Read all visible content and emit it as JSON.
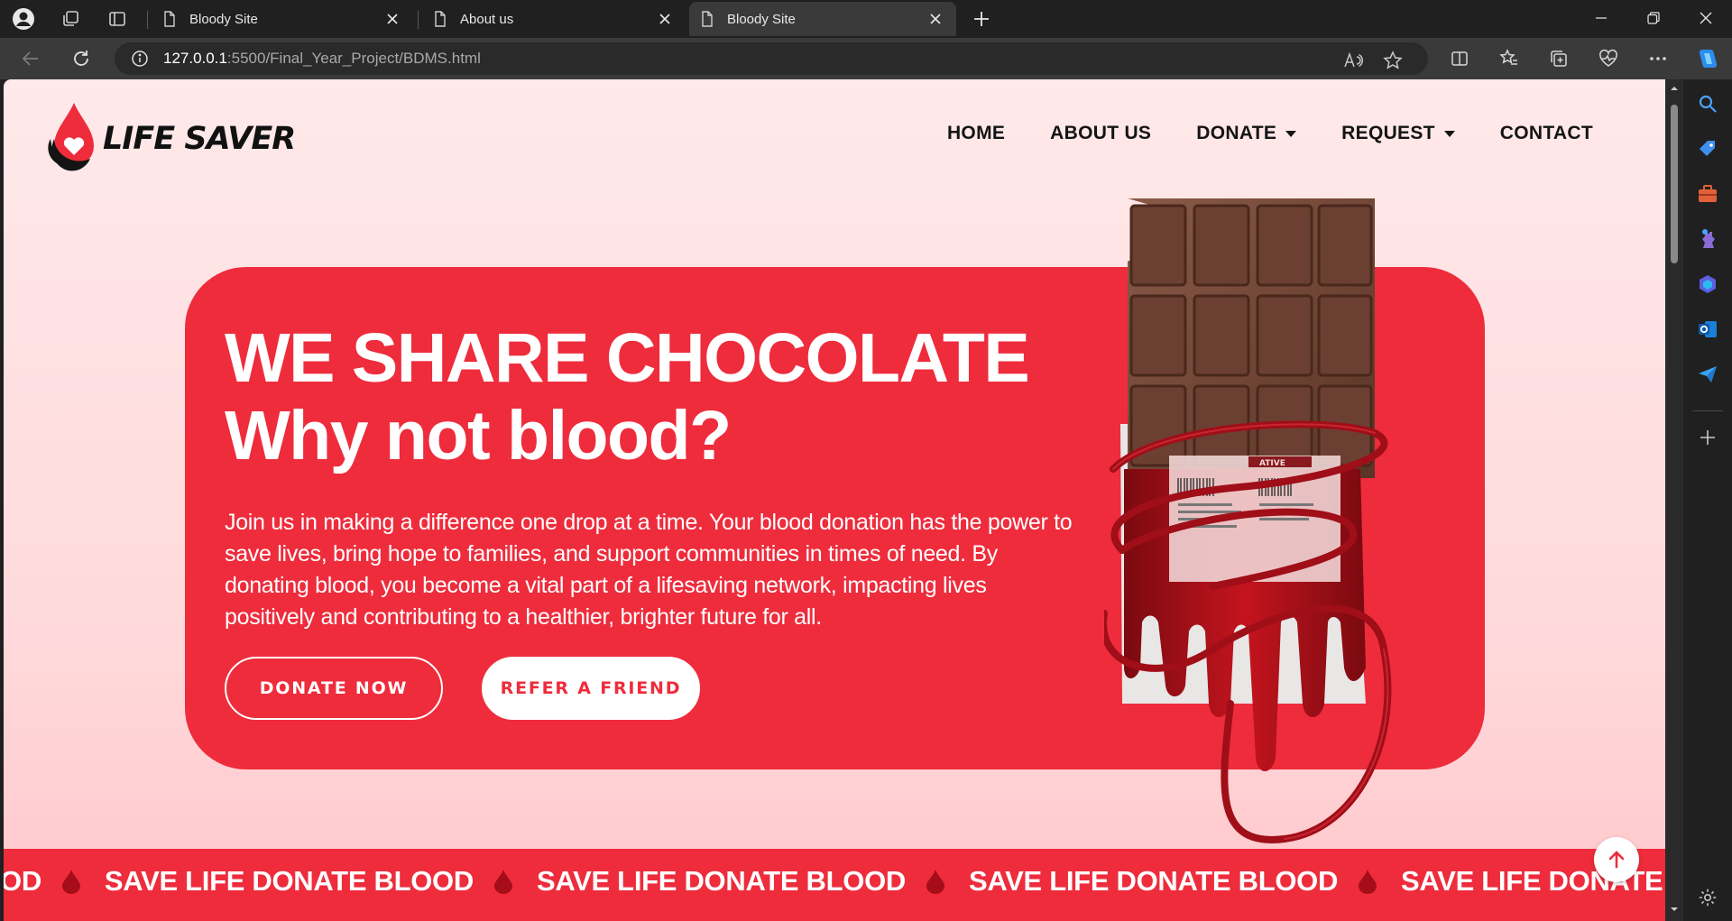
{
  "browser": {
    "tabs": [
      {
        "title": "Bloody Site",
        "active": false
      },
      {
        "title": "About us",
        "active": false
      },
      {
        "title": "Bloody Site",
        "active": true
      }
    ],
    "url_host": "127.0.0.1",
    "url_rest": ":5500/Final_Year_Project/BDMS.html"
  },
  "site": {
    "logo_text": "LIFE SAVER",
    "nav": [
      {
        "label": "HOME",
        "dropdown": false
      },
      {
        "label": "ABOUT US",
        "dropdown": false
      },
      {
        "label": "DONATE",
        "dropdown": true
      },
      {
        "label": "REQUEST",
        "dropdown": true
      },
      {
        "label": "CONTACT",
        "dropdown": false
      }
    ]
  },
  "hero": {
    "title_line1": "WE SHARE CHOCOLATE",
    "title_line2": "Why not blood?",
    "description": "Join us in making a difference one drop at a time. Your blood donation has the power to save lives, bring hope to families, and support communities in times of need. By donating blood, you become a vital part of a lifesaving network, impacting lives positively and contributing to a healthier, brighter future for all.",
    "donate_label": "DONATE NOW",
    "refer_label": "REFER A FRIEND",
    "bag_label": "ATIVE"
  },
  "ticker": {
    "text": "SAVE LIFE DONATE BLOOD",
    "lead_fragment": "OD"
  },
  "colors": {
    "brand_red": "#ee2c3c",
    "page_bg": "#ffe9ea",
    "chrome_dark": "#202020"
  }
}
